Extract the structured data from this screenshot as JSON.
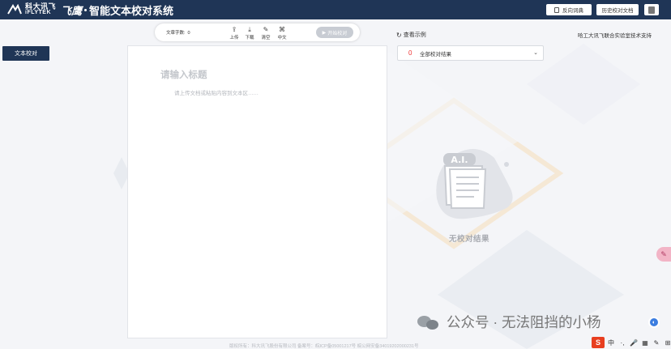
{
  "header": {
    "logo_cn": "科大讯飞",
    "logo_en": "iFLYTEK",
    "logo_fei": "飞鹰",
    "title": "智能文本校对系统",
    "feedback_label": "反向词典",
    "history_label": "历史校对文档"
  },
  "sidebar": {
    "items": [
      {
        "label": "文本校对"
      }
    ]
  },
  "toolbar": {
    "word_count_label": "文章字数:",
    "word_count_value": "0",
    "tools": [
      {
        "label": "上传",
        "icon": "upload-icon"
      },
      {
        "label": "下载",
        "icon": "download-icon"
      },
      {
        "label": "清空",
        "icon": "clear-icon"
      },
      {
        "label": "中文",
        "icon": "language-icon"
      }
    ],
    "check_label": "开始校对"
  },
  "editor": {
    "title_placeholder": "请输入标题",
    "body_placeholder": "请上传文档或粘贴内容到文本区……"
  },
  "right_panel": {
    "example_label": "查看示例",
    "support_text": "哈工大讯飞联合实验室技术支持",
    "result_count": "0",
    "result_filter": "全部校对结果",
    "empty_text": "无校对结果",
    "illustration_text": "A.I."
  },
  "footer": {
    "text": "版权所有：科大讯飞股份有限公司  备案号：皖ICP备05001217号  皖公网安备34019202000231号"
  },
  "watermark": {
    "text": "公众号 · 无法阻挡的小杨"
  },
  "ime": {
    "logo": "S",
    "items": [
      "中",
      "·,",
      "🎤",
      "▦",
      "✎",
      "⊞"
    ]
  },
  "colors": {
    "header_bg": "#1f3556",
    "accent_red": "#e33333",
    "button_disabled": "#c8ccd3"
  }
}
